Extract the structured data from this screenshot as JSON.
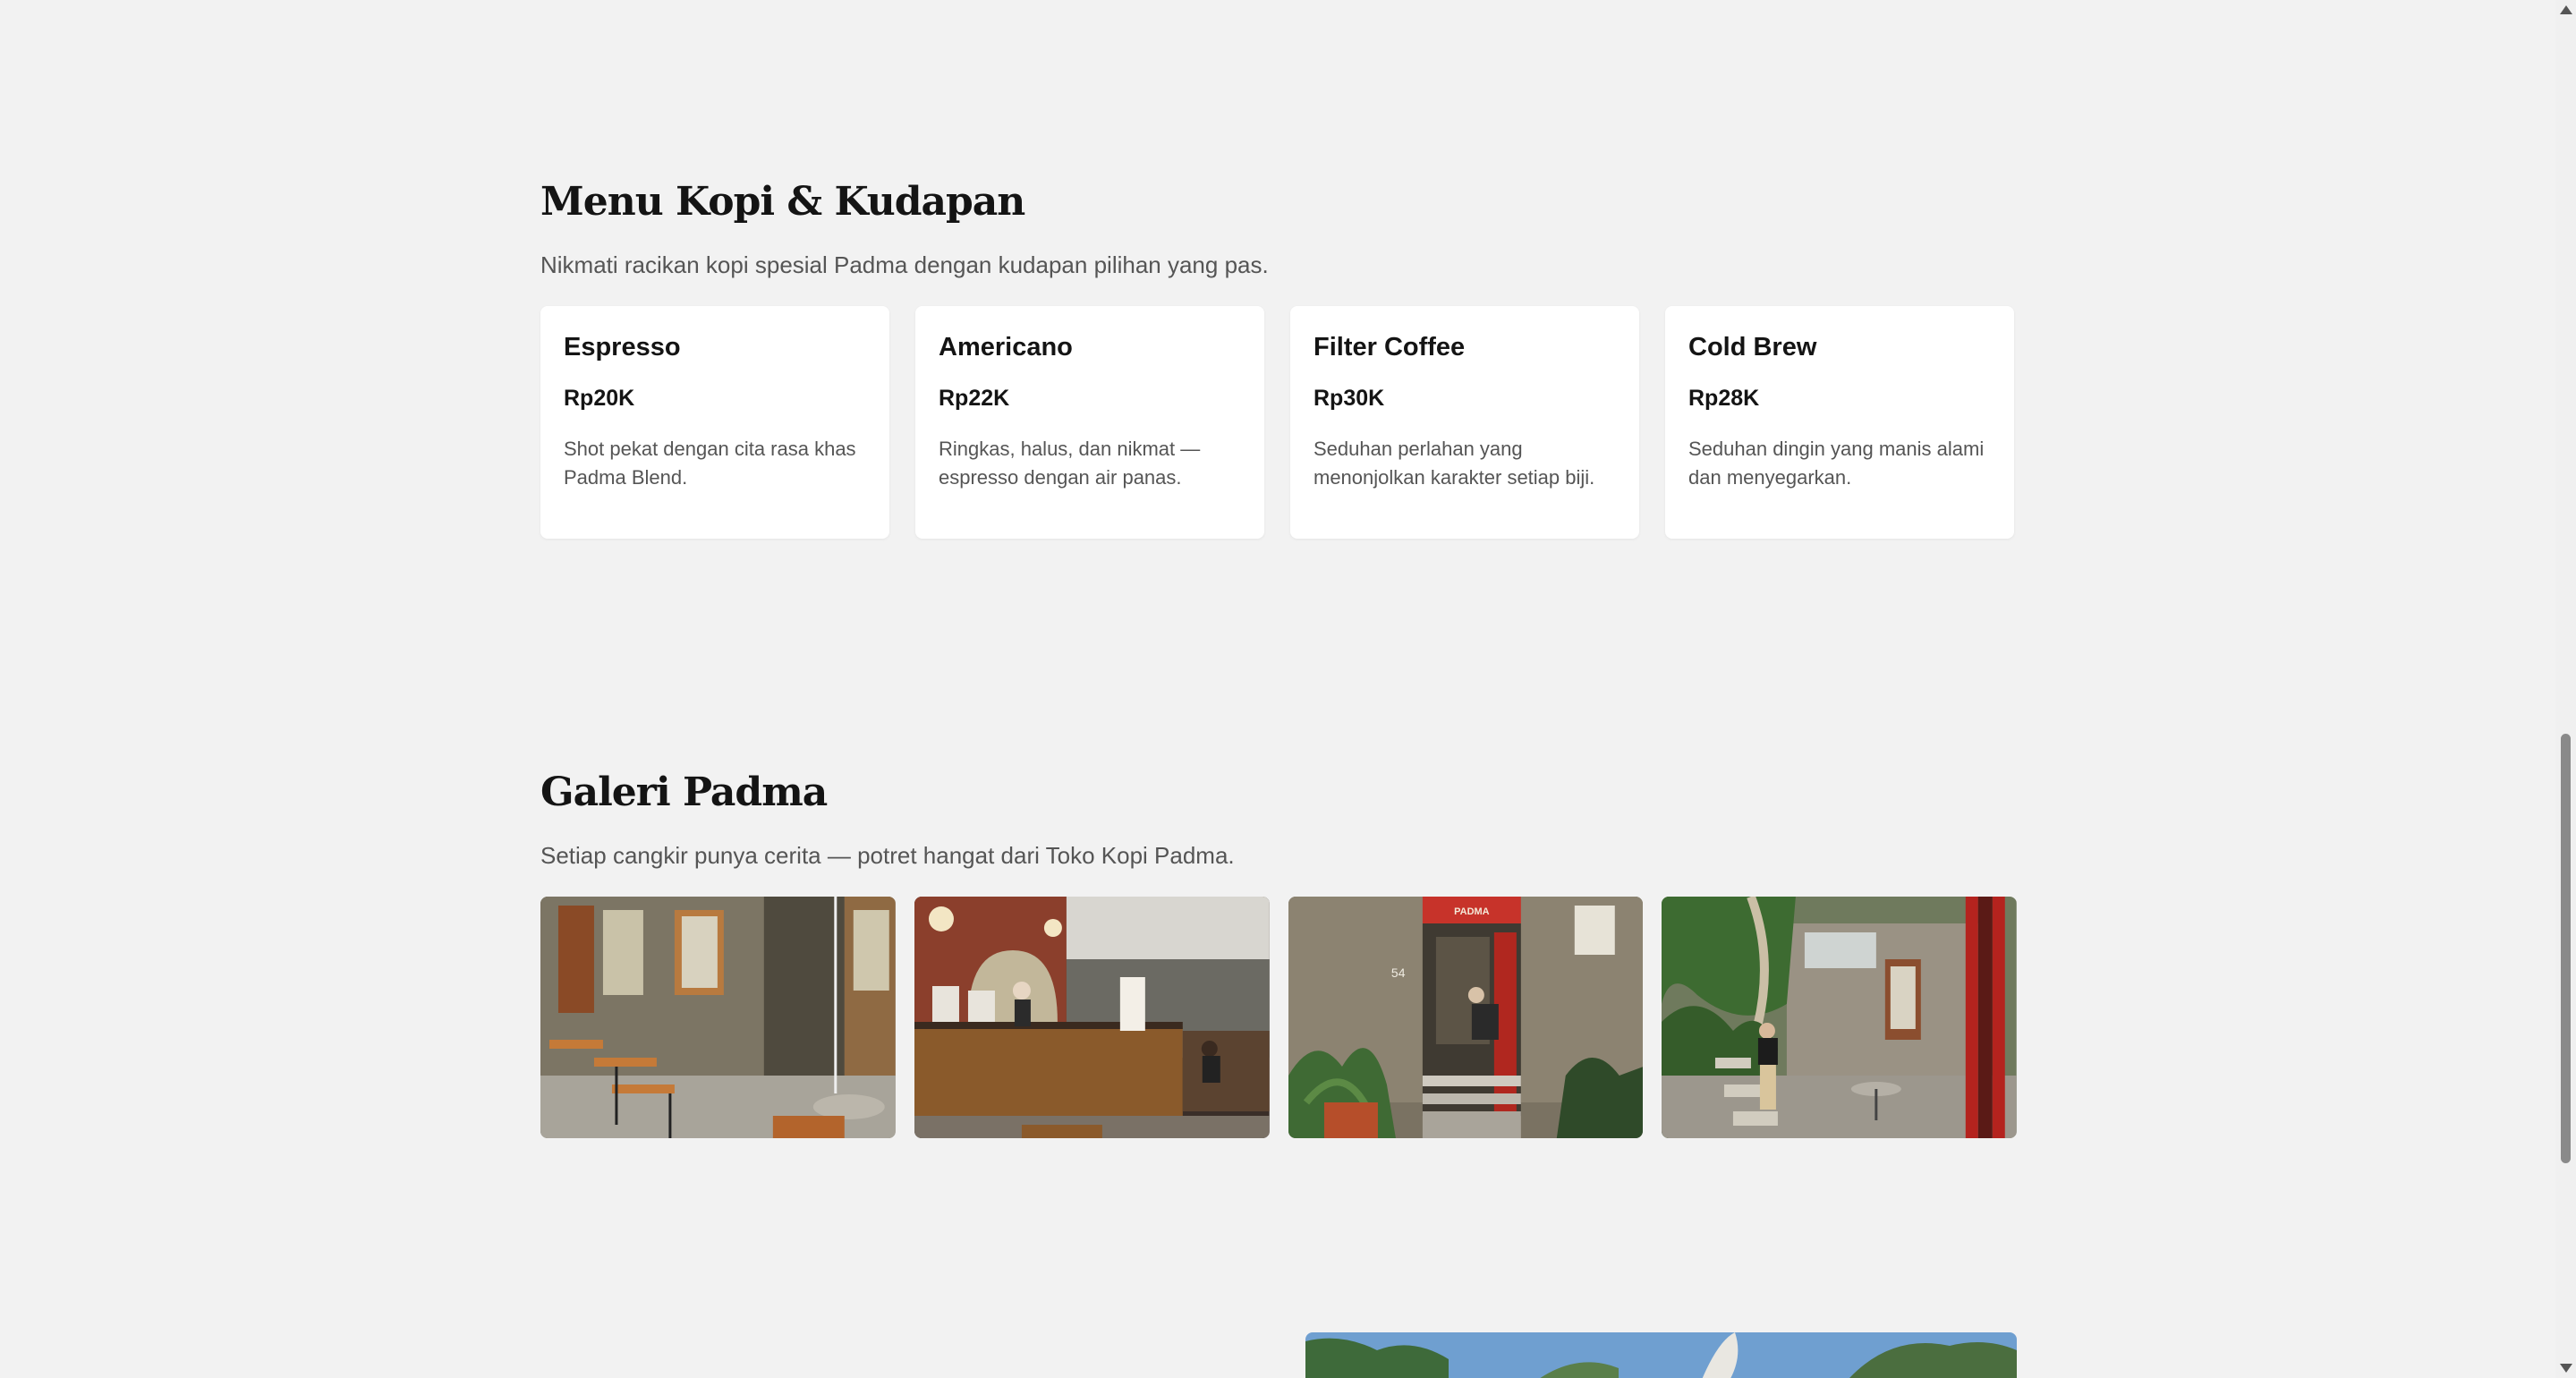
{
  "menu": {
    "title": "Menu Kopi & Kudapan",
    "subtitle": "Nikmati racikan kopi spesial Padma dengan kudapan pilihan yang pas.",
    "items": [
      {
        "name": "Espresso",
        "price": "Rp20K",
        "desc": "Shot pekat dengan cita rasa khas Padma Blend."
      },
      {
        "name": "Americano",
        "price": "Rp22K",
        "desc": "Ringkas, halus, dan nikmat — espresso dengan air panas."
      },
      {
        "name": "Filter Coffee",
        "price": "Rp30K",
        "desc": "Seduhan perlahan yang menonjolkan karakter setiap biji."
      },
      {
        "name": "Cold Brew",
        "price": "Rp28K",
        "desc": "Seduhan dingin yang manis alami dan menyegarkan."
      }
    ]
  },
  "gallery": {
    "title": "Galeri Padma",
    "subtitle": "Setiap cangkir punya cerita — potret hangat dari Toko Kopi Padma.",
    "photos": [
      {
        "subject": "courtyard-stone-wall-seating"
      },
      {
        "subject": "cafe-interior-coffee-bar"
      },
      {
        "subject": "entrance-doorway-with-plants",
        "door_number": "54",
        "sign_text": "PADMA"
      },
      {
        "subject": "garden-path-with-visitor"
      }
    ]
  },
  "colors": {
    "background": "#f2f2f2",
    "card": "#ffffff",
    "heading": "#141414",
    "muted": "#555555"
  }
}
